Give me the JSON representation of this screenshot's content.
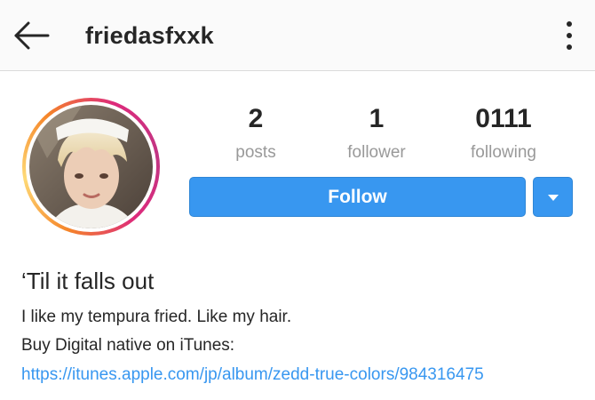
{
  "header": {
    "back_icon": "arrow-left-icon",
    "username": "friedasfxxk",
    "menu_icon": "more-vertical-icon"
  },
  "profile": {
    "avatar_icon": "profile-photo",
    "stats": [
      {
        "value": "2",
        "label": "posts"
      },
      {
        "value": "1",
        "label": "follower"
      },
      {
        "value": "0111",
        "label": "following"
      }
    ],
    "follow_label": "Follow",
    "dropdown_icon": "caret-down-icon"
  },
  "bio": {
    "name": "‘Til it falls out",
    "line1": "I like my tempura fried. Like my hair.",
    "line2": "Buy Digital native on iTunes:",
    "link": "https://itunes.apple.com/jp/album/zedd-true-colors/984316475"
  },
  "colors": {
    "accent": "#3897f0",
    "text": "#262626",
    "muted": "#999999",
    "ring_start": "#f58529",
    "ring_end": "#c13584"
  }
}
